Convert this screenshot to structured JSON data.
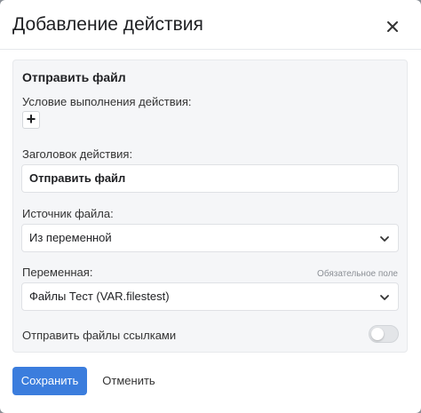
{
  "modal": {
    "title": "Добавление действия",
    "close_icon": "close-icon"
  },
  "panel": {
    "title": "Отправить файл",
    "condition_label": "Условие выполнения действия:",
    "add_icon": "plus-icon",
    "action_title_label": "Заголовок действия:",
    "action_title_value": "Отправить файл",
    "file_source_label": "Источник файла:",
    "file_source_value": "Из переменной",
    "variable_label": "Переменная:",
    "variable_required": "Обязательное поле",
    "variable_value": "Файлы Тест (VAR.filestest)",
    "send_links_label": "Отправить файлы ссылками",
    "send_links_enabled": false
  },
  "footer": {
    "save_label": "Сохранить",
    "cancel_label": "Отменить"
  },
  "colors": {
    "accent": "#3b7ddd",
    "panel_bg": "#f5f6f8"
  }
}
